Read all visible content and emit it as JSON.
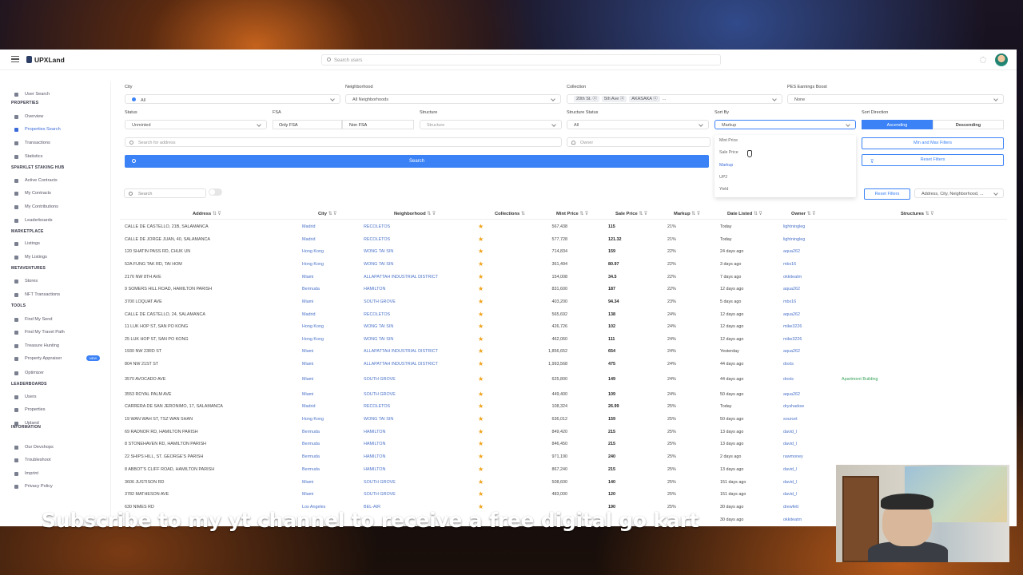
{
  "app": {
    "brand": "UPXLand",
    "search_placeholder": "Search users"
  },
  "sidebar": {
    "user_search": "User Search",
    "sections": [
      {
        "label": "PROPERTIES",
        "items": [
          "Overview",
          "Properties Search",
          "Transactions",
          "Statistics"
        ]
      },
      {
        "label": "SPARKLET STAKING HUB",
        "items": [
          "Active Contracts",
          "My Contracts",
          "My Contributions",
          "Leaderboards"
        ]
      },
      {
        "label": "MARKETPLACE",
        "items": [
          "Listings",
          "My Listings"
        ]
      },
      {
        "label": "METAVENTURES",
        "items": [
          "Stores",
          "NFT Transactions"
        ]
      },
      {
        "label": "TOOLS",
        "items": [
          "Find My Send",
          "Find My Travel Path",
          "Treasure Hunting",
          "Property Appraiser",
          "Optimizer"
        ]
      },
      {
        "label": "LEADERBOARDS",
        "items": [
          "Users",
          "Properties",
          "Upland"
        ]
      },
      {
        "label": "INFORMATION",
        "items": [
          "Our Devshops",
          "Troubleshoot",
          "Imprint",
          "Privacy Policy"
        ]
      }
    ],
    "active": "Properties Search",
    "new_badge": "NEW"
  },
  "filters": {
    "city": {
      "label": "City",
      "value": "All"
    },
    "neighborhood": {
      "label": "Neighborhood",
      "value": "All Neighborhoods"
    },
    "collection": {
      "label": "Collection",
      "chips": [
        "20th St. ⓧ",
        "5th Ave ⓧ",
        "AKASAKA ⓧ"
      ],
      "more": "..."
    },
    "pes": {
      "label": "PES Earnings Boost",
      "value": "None"
    },
    "status": {
      "label": "Status",
      "value": "Unminted"
    },
    "fsa": {
      "label": "FSA",
      "only": "Only FSA",
      "non": "Non FSA"
    },
    "structure": {
      "label": "Structure",
      "value": "Structure"
    },
    "structure_status": {
      "label": "Structure Status",
      "value": "All"
    },
    "sort_by": {
      "label": "Sort By",
      "value": "Markup",
      "options": [
        "Mint Price",
        "Sale Price",
        "Markup",
        "UP2",
        "Yield"
      ]
    },
    "sort_direction": {
      "label": "Sort Direction",
      "asc": "Ascending",
      "desc": "Descending"
    },
    "address_placeholder": "Search for address",
    "owner_placeholder": "Owner",
    "search_label": "Search",
    "min_max": "Min and Max Filters",
    "reset": "Reset Filters"
  },
  "table": {
    "search_placeholder": "Search",
    "reset": "Reset Filters",
    "column_select": "Address, City, Neighborhood, ...",
    "columns": [
      "Address",
      "City",
      "Neighborhood",
      "Collections",
      "Mint Price",
      "Sale Price",
      "Markup",
      "Date Listed",
      "Owner",
      "Structures"
    ],
    "rows": [
      [
        "CALLE DE CASTELLO, 21B, SALAMANCA",
        "Madrid",
        "RECOLETOS",
        "567,438",
        "115",
        "21%",
        "Today",
        "lightningleg",
        ""
      ],
      [
        "CALLE DE JORGE JUAN, 40, SALAMANCA",
        "Madrid",
        "RECOLETOS",
        "577,728",
        "121.32",
        "21%",
        "Today",
        "lightningleg",
        ""
      ],
      [
        "120 SHATIN PASS RD, CHUK UN",
        "Hong Kong",
        "WONG TAI SIN",
        "714,834",
        "159",
        "22%",
        "24 days ago",
        "aqua262",
        ""
      ],
      [
        "52A FUNG TAK RD, TAI HOM",
        "Hong Kong",
        "WONG TAI SIN",
        "361,494",
        "80.97",
        "22%",
        "3 days ago",
        "mbx16",
        ""
      ],
      [
        "2176 NW 8TH AVE",
        "Miami",
        "ALLAPATTAH INDUSTRIAL DISTRICT",
        "154,008",
        "34.5",
        "22%",
        "7 days ago",
        "okkiteatm",
        ""
      ],
      [
        "9 SOMERS HILL ROAD, HAMILTON PARISH",
        "Bermuda",
        "HAMILTON",
        "831,600",
        "187",
        "22%",
        "12 days ago",
        "aqua262",
        ""
      ],
      [
        "3700 LOQUAT AVE",
        "Miami",
        "SOUTH GROVE",
        "403,200",
        "94.34",
        "23%",
        "5 days ago",
        "mbx16",
        ""
      ],
      [
        "CALLE DE CASTELLO, 24, SALAMANCA",
        "Madrid",
        "RECOLETOS",
        "565,692",
        "138",
        "24%",
        "12 days ago",
        "aqua262",
        ""
      ],
      [
        "11 LUK HOP ST, SAN PO KONG",
        "Hong Kong",
        "WONG TAI SIN",
        "426,726",
        "102",
        "24%",
        "12 days ago",
        "mike3226",
        ""
      ],
      [
        "25 LUK HOP ST, SAN PO KONG",
        "Hong Kong",
        "WONG TAI SIN",
        "462,060",
        "111",
        "24%",
        "12 days ago",
        "mike3226",
        ""
      ],
      [
        "1930 NW 23RD ST",
        "Miami",
        "ALLAPATTAH INDUSTRIAL DISTRICT",
        "1,856,652",
        "654",
        "24%",
        "Yesterday",
        "aqua262",
        ""
      ],
      [
        "804 NW 21ST ST",
        "Miami",
        "ALLAPATTAH INDUSTRIAL DISTRICT",
        "1,993,568",
        "475",
        "24%",
        "44 days ago",
        "doxts",
        ""
      ],
      [
        "3570 AVOCADO AVE",
        "Miami",
        "SOUTH GROVE",
        "625,800",
        "149",
        "24%",
        "44 days ago",
        "doxts",
        "Apartment Building"
      ],
      [
        "3553 ROYAL PALM AVE",
        "Miami",
        "SOUTH GROVE",
        "449,400",
        "109",
        "24%",
        "50 days ago",
        "aqua262",
        ""
      ],
      [
        "CARRERA DE SAN JERONIMO, 17, SALAMANCA",
        "Madrid",
        "RECOLETOS",
        "108,324",
        "26.99",
        "25%",
        "Today",
        "dryshadow",
        ""
      ],
      [
        "19 WAN WAH ST, TSZ WAN SHAN",
        "Hong Kong",
        "WONG TAI SIN",
        "636,012",
        "159",
        "25%",
        "50 days ago",
        "sourcet",
        ""
      ],
      [
        "69 RADNOR RD, HAMILTON PARISH",
        "Bermuda",
        "HAMILTON",
        "849,420",
        "215",
        "25%",
        "13 days ago",
        "david_l",
        ""
      ],
      [
        "8 STONEHAVEN RD, HAMILTON PARISH",
        "Bermuda",
        "HAMILTON",
        "846,450",
        "215",
        "25%",
        "13 days ago",
        "david_l",
        ""
      ],
      [
        "22 SHIPS HILL, ST. GEORGE'S PARISH",
        "Bermuda",
        "HAMILTON",
        "971,190",
        "240",
        "25%",
        "2 days ago",
        "rawmoney",
        ""
      ],
      [
        "8 ABBOT'S CLIFF ROAD, HAMILTON PARISH",
        "Bermuda",
        "HAMILTON",
        "867,240",
        "215",
        "25%",
        "13 days ago",
        "david_l",
        ""
      ],
      [
        "3606 JUSTISON RD",
        "Miami",
        "SOUTH GROVE",
        "508,600",
        "140",
        "25%",
        "151 days ago",
        "david_l",
        ""
      ],
      [
        "3782 MATHESON AVE",
        "Miami",
        "SOUTH GROVE",
        "483,000",
        "120",
        "25%",
        "151 days ago",
        "david_l",
        ""
      ],
      [
        "630 NIMES RD",
        "Los Angeles",
        "BEL-AIR",
        "",
        "190",
        "25%",
        "30 days ago",
        "drewfett",
        ""
      ],
      [
        "",
        "",
        "",
        "",
        "",
        "",
        "30 days ago",
        "okkiteatm",
        ""
      ]
    ]
  },
  "caption": "Subscribe to my yt channel to receive a free digital go kart",
  "colors": {
    "accent": "#3b82f6",
    "link": "#4a72c8",
    "star": "#f0a21a",
    "structure_green": "#3aa35a"
  }
}
